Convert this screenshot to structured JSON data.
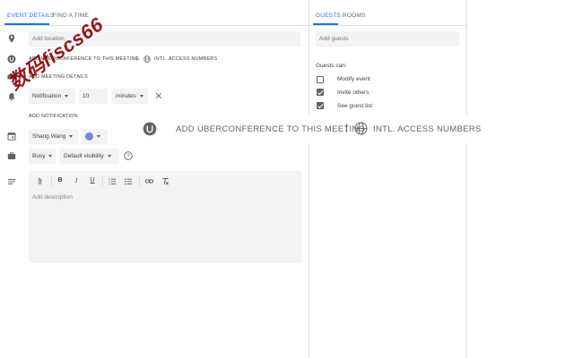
{
  "tabs": [
    {
      "label": "EVENT DETAILS",
      "active": true
    },
    {
      "label": "FIND A TIME",
      "active": false
    }
  ],
  "right_tabs": [
    {
      "label": "GUESTS",
      "active": true
    },
    {
      "label": "ROOMS",
      "active": false
    }
  ],
  "location": {
    "placeholder": "Add location"
  },
  "conference_small": {
    "add_label": "ADD UBERCONFERENCE TO THIS MEETING",
    "separator": "|",
    "access_label": "INTL. ACCESS NUMBERS"
  },
  "meeting_details_label": "ADD MEETING DETAILS",
  "notification": {
    "type": "Notification",
    "amount": "10",
    "unit": "minutes"
  },
  "add_notification_label": "ADD NOTIFICATION",
  "calendar": {
    "owner": "Shang Wang",
    "color": "#7986cb"
  },
  "availability": {
    "status": "Busy",
    "visibility": "Default visibility"
  },
  "description": {
    "placeholder": "Add description"
  },
  "guests": {
    "placeholder": "Add guests",
    "can_label": "Guests can:",
    "permissions": [
      {
        "label": "Modify event",
        "checked": false
      },
      {
        "label": "Invite others",
        "checked": true
      },
      {
        "label": "See guest list",
        "checked": true
      }
    ]
  },
  "conference_large": {
    "add_label": "ADD UBERCONFERENCE TO THIS MEETING",
    "separator": "|",
    "access_label": "INTL. ACCESS NUMBERS"
  },
  "watermark": "数码fiscs66",
  "colors": {
    "accent": "#1a73e8",
    "field_bg": "#f1f3f4",
    "watermark": "#8b0000"
  }
}
